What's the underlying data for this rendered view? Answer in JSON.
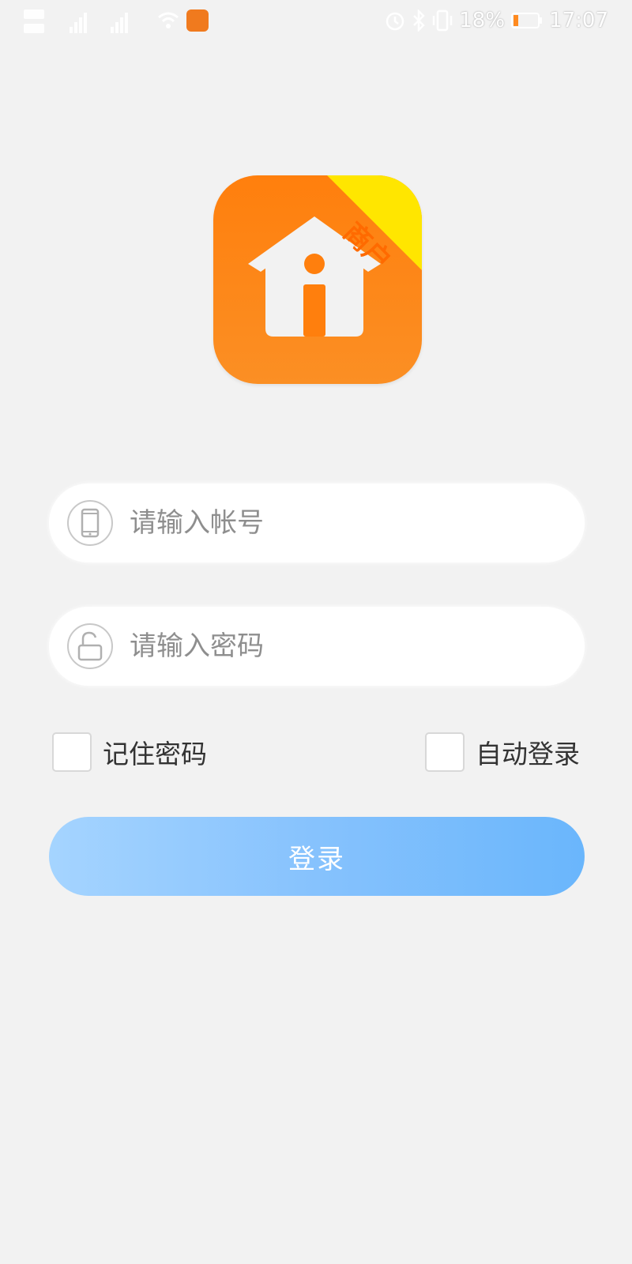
{
  "status_bar": {
    "battery": "18%",
    "time": "17:07",
    "icons": [
      "signal-icon",
      "wifi-icon",
      "app-notification-icon",
      "alarm-icon",
      "bluetooth-icon",
      "vibrate-icon",
      "battery-icon"
    ]
  },
  "logo": {
    "badge_text": "商户",
    "icon": "house-icon",
    "colors": {
      "primary": "#ff7f0d",
      "badge": "#ffe600"
    }
  },
  "form": {
    "account": {
      "placeholder": "请输入帐号",
      "value": "",
      "icon": "phone-icon"
    },
    "password": {
      "placeholder": "请输入密码",
      "value": "",
      "icon": "unlock-icon"
    },
    "remember_password": {
      "label": "记住密码",
      "checked": false
    },
    "auto_login": {
      "label": "自动登录",
      "checked": false
    },
    "login_button": {
      "label": "登录"
    }
  },
  "colors": {
    "background": "#f2f2f2",
    "button_gradient_start": "#a5d4ff",
    "button_gradient_end": "#6ab6fc"
  }
}
